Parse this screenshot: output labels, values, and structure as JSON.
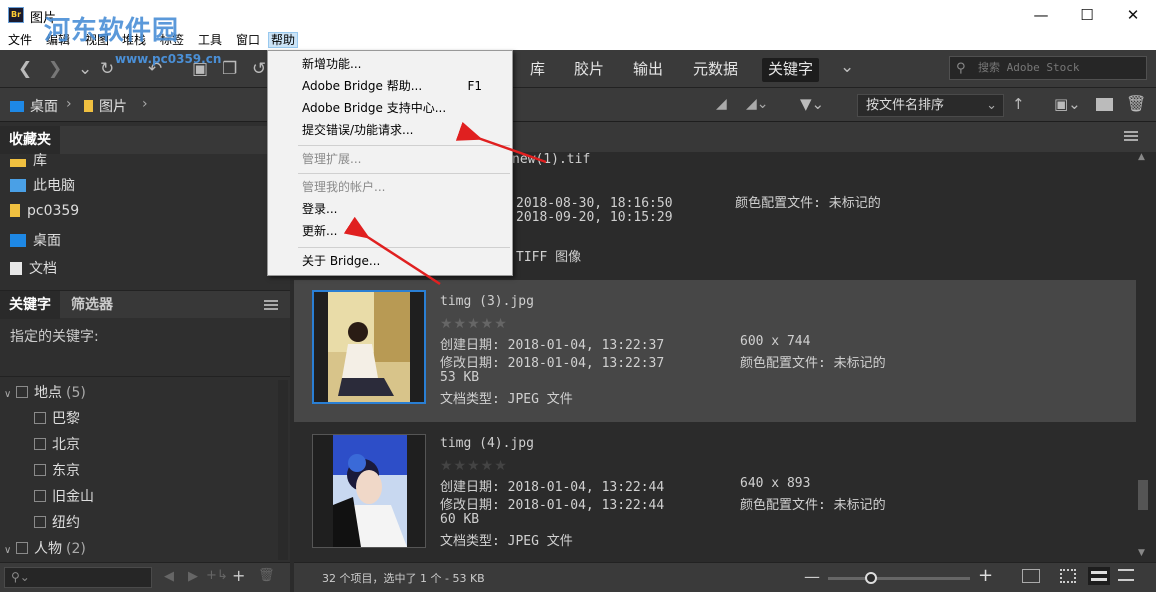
{
  "window": {
    "title": "图片",
    "app_icon": "Br",
    "controls": [
      "minimize",
      "maximize",
      "close"
    ]
  },
  "watermark": {
    "text": "河东软件园",
    "url": "www.pc0359.cn"
  },
  "menubar": {
    "items": [
      "文件",
      "编辑",
      "视图",
      "堆栈",
      "标签",
      "工具",
      "窗口",
      "帮助"
    ],
    "active": "帮助"
  },
  "toolbar": {
    "workspaces": [
      "库",
      "胶片",
      "输出",
      "元数据",
      "关键字"
    ],
    "selected_workspace": "关键字",
    "search_placeholder": "搜索 Adobe Stock"
  },
  "pathbar": {
    "crumbs": [
      "桌面",
      "图片"
    ],
    "sort_label": "按文件名排序"
  },
  "favorites": {
    "tab": "收藏夹",
    "items": [
      {
        "label": "库",
        "icon": "library-icon"
      },
      {
        "label": "此电脑",
        "icon": "computer-icon"
      },
      {
        "label": "pc0359",
        "icon": "folder-icon"
      },
      {
        "label": "桌面",
        "icon": "desktop-icon"
      },
      {
        "label": "文档",
        "icon": "documents-icon"
      }
    ]
  },
  "keywords": {
    "tabs": [
      "关键字",
      "筛选器"
    ],
    "assigned_label": "指定的关键字:",
    "tree": [
      {
        "label": "地点",
        "count": "(5)",
        "type": "group"
      },
      {
        "label": "巴黎",
        "type": "child"
      },
      {
        "label": "北京",
        "type": "child"
      },
      {
        "label": "东京",
        "type": "child"
      },
      {
        "label": "旧金山",
        "type": "child"
      },
      {
        "label": "纽约",
        "type": "child"
      },
      {
        "label": "人物",
        "count": "(2)",
        "type": "group"
      }
    ]
  },
  "files": [
    {
      "name": "new(1).tif",
      "rows": [
        "2018-08-30, 18:16:50        颜色配置文件: 未标记的",
        "2018-09-20, 10:15:29",
        "",
        "TIFF 图像"
      ]
    },
    {
      "name": "timg (3).jpg",
      "created": "创建日期: 2018-01-04, 13:22:37",
      "dims": "600 x 744",
      "modified": "修改日期: 2018-01-04, 13:22:37",
      "profile": "颜色配置文件: 未标记的",
      "size": "53 KB",
      "type": "文档类型: JPEG 文件",
      "stars": "★★★★★",
      "selected": true
    },
    {
      "name": "timg (4).jpg",
      "created": "创建日期: 2018-01-04, 13:22:44",
      "dims": "640 x 893",
      "modified": "修改日期: 2018-01-04, 13:22:44",
      "profile": "颜色配置文件: 未标记的",
      "size": "60 KB",
      "type": "文档类型: JPEG 文件",
      "stars": "★★★★★",
      "selected": false
    }
  ],
  "status": {
    "text": "32 个项目，选中了 1 个 - 53 KB",
    "zoom_level": 0.3
  },
  "help_menu": {
    "items": [
      {
        "label": "新增功能...",
        "enabled": true
      },
      {
        "label": "Adobe Bridge 帮助...",
        "shortcut": "F1",
        "enabled": true
      },
      {
        "label": "Adobe Bridge 支持中心...",
        "enabled": true
      },
      {
        "label": "提交错误/功能请求...",
        "enabled": true
      },
      {
        "label": "管理扩展...",
        "enabled": false
      },
      {
        "label": "管理我的帐户...",
        "enabled": false
      },
      {
        "label": "登录...",
        "enabled": true
      },
      {
        "label": "更新...",
        "enabled": true
      },
      {
        "label": "关于 Bridge...",
        "enabled": true
      }
    ]
  },
  "colors": {
    "accent": "#2a7fd4",
    "annotation_arrow": "#e02020",
    "panel": "#2f2f2f"
  }
}
